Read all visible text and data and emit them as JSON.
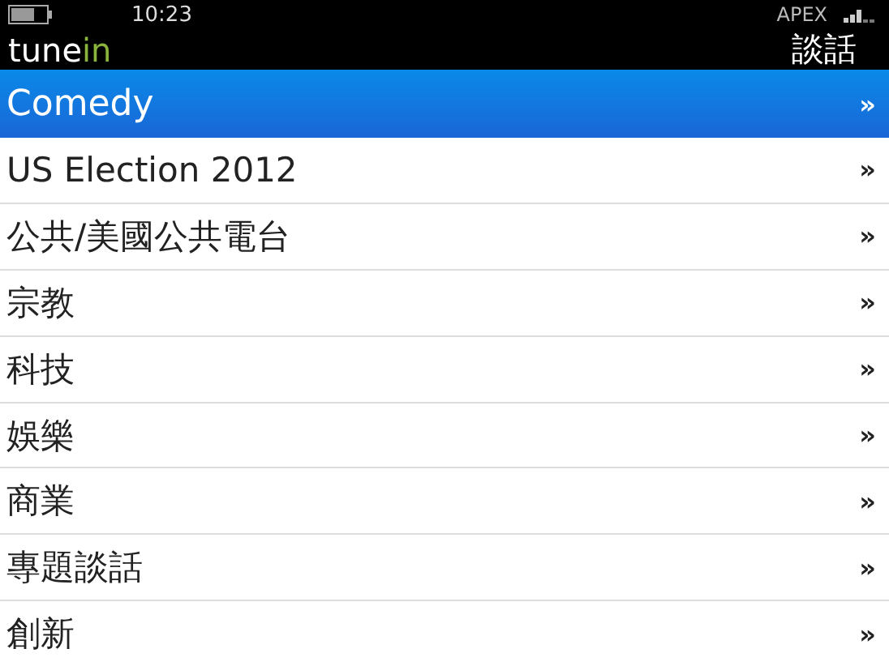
{
  "status_bar": {
    "time": "10:23",
    "carrier": "APEX"
  },
  "header": {
    "logo": {
      "main": "tune",
      "accent": "in"
    },
    "title": "談話"
  },
  "list": [
    {
      "label": "Comedy",
      "chevron": "»",
      "selected": true
    },
    {
      "label": "US Election 2012",
      "chevron": "»",
      "selected": false
    },
    {
      "label": "公共/美國公共電台",
      "chevron": "»",
      "selected": false
    },
    {
      "label": "宗教",
      "chevron": "»",
      "selected": false
    },
    {
      "label": "科技",
      "chevron": "»",
      "selected": false
    },
    {
      "label": "娛樂",
      "chevron": "»",
      "selected": false
    },
    {
      "label": "商業",
      "chevron": "»",
      "selected": false
    },
    {
      "label": "專題談話",
      "chevron": "»",
      "selected": false
    },
    {
      "label": "創新",
      "chevron": "»",
      "selected": false
    }
  ]
}
